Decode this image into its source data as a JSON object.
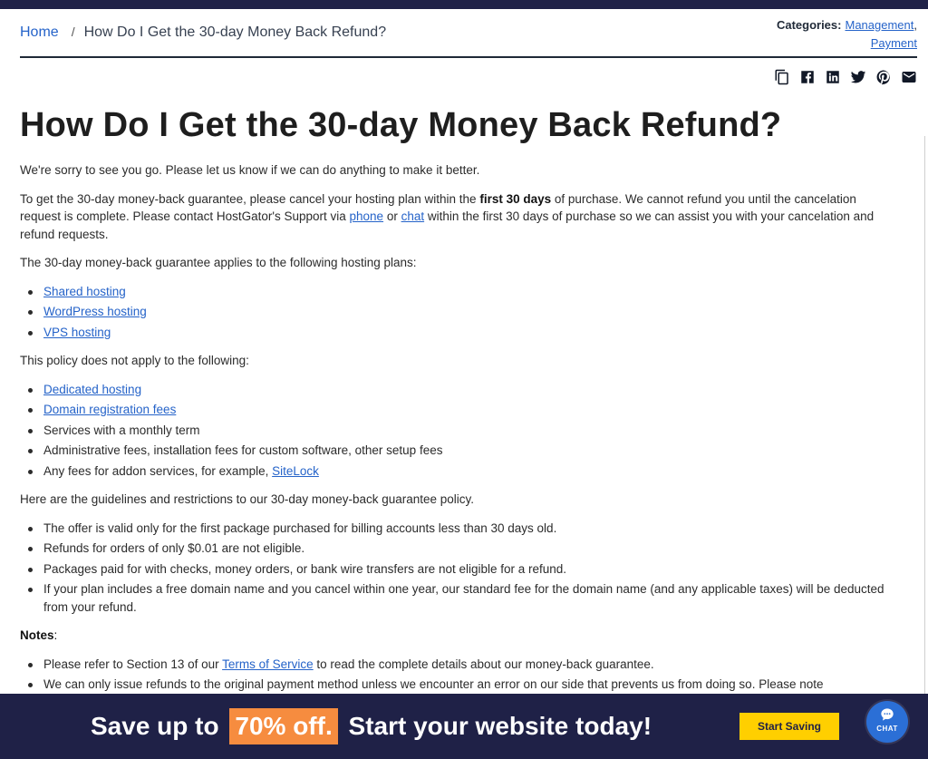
{
  "breadcrumb": {
    "home": "Home",
    "separator": "/",
    "current": "How Do I Get the 30-day Money Back Refund?"
  },
  "categories": {
    "label": "Categories:",
    "items": [
      "Management",
      "Payment"
    ],
    "comma": ","
  },
  "share_icons": [
    "copy-icon",
    "facebook-icon",
    "linkedin-icon",
    "twitter-icon",
    "pinterest-icon",
    "email-icon"
  ],
  "article": {
    "title": "How Do I Get the 30-day Money Back Refund?",
    "intro": "We're sorry to see you go. Please let us know if we can do anything to make it better.",
    "guarantee": {
      "part1": "To get the 30-day money-back guarantee, please cancel your hosting plan within the ",
      "bold": "first 30 days",
      "part2": " of purchase. We cannot refund you until the cancelation request is complete. Please contact HostGator's Support via ",
      "phone_link": "phone",
      "or": " or ",
      "chat_link": "chat",
      "part3": " within the first 30 days of purchase so we can assist you with your cancelation and refund requests."
    },
    "applies_intro": "The 30-day money-back guarantee applies to the following hosting plans:",
    "applies_list": [
      "Shared hosting",
      "WordPress hosting",
      "VPS hosting"
    ],
    "not_apply_intro": "This policy does not apply to the following:",
    "not_apply": {
      "dedicated": "Dedicated hosting",
      "domain": "Domain registration fees",
      "monthly": "Services with a monthly term",
      "admin": "Administrative fees, installation fees for custom software, other setup fees",
      "addon_text": "Any fees for addon services, for example, ",
      "addon_link": "SiteLock"
    },
    "guidelines_intro": "Here are the guidelines and restrictions to our 30-day money-back guarantee policy.",
    "guidelines": [
      "The offer is valid only for the first package purchased for billing accounts less than 30 days old.",
      "Refunds for orders of only $0.01 are not eligible.",
      "Packages paid for with checks, money orders, or bank wire transfers are not eligible for a refund.",
      "If your plan includes a free domain name and you cancel within one year, our standard fee for the domain name (and any applicable taxes) will be deducted from your refund."
    ],
    "notes_label": "Notes",
    "notes_colon": ":",
    "note1": {
      "before": "Please refer to Section 13 of our ",
      "link": "Terms of Service",
      "after": " to read the complete details about our money-back guarantee."
    },
    "note2": "We can only issue refunds to the original payment method unless we encounter an error on our side that prevents us from doing so. Please note"
  },
  "promo": {
    "text_before": "Save up to ",
    "highlight": "70% off.",
    "text_after": " Start your website today!",
    "button": "Start Saving",
    "chat_label": "CHAT"
  },
  "colors": {
    "navy": "#1f2147",
    "link": "#2563c9",
    "highlight": "#f68c3f",
    "cta": "#ffcf00",
    "chat": "#2b6fd6"
  }
}
